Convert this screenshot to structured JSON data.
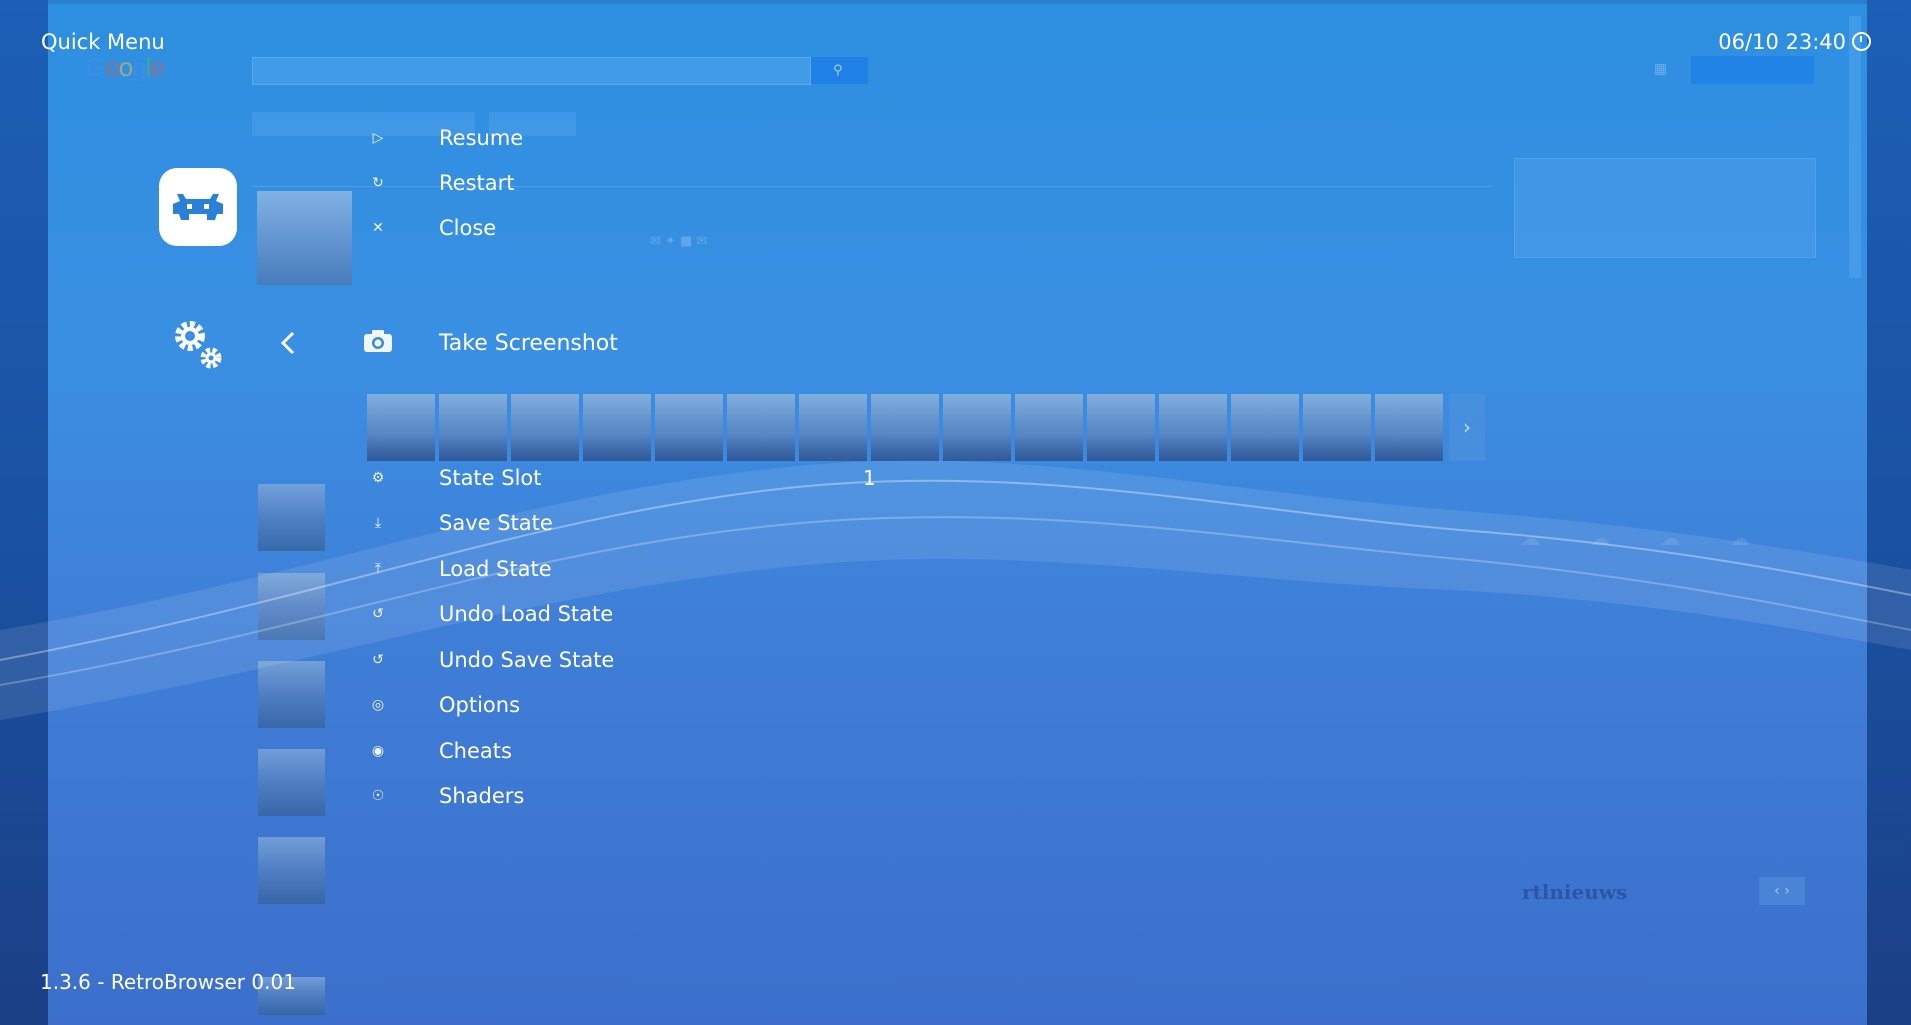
{
  "header": {
    "title": "Quick Menu",
    "clock": "06/10 23:40"
  },
  "footer": {
    "version": "1.3.6 - RetroBrowser 0.01"
  },
  "background_page": {
    "logo": "Google",
    "news_logo": "rtlnieuws"
  },
  "menu_top": [
    {
      "label": "Resume",
      "icon": "play-icon"
    },
    {
      "label": "Restart",
      "icon": "restart-icon"
    },
    {
      "label": "Close",
      "icon": "close-icon"
    }
  ],
  "screenshot_item": {
    "label": "Take Screenshot",
    "icon": "camera-icon"
  },
  "menu_items": [
    {
      "label": "State Slot",
      "icon": "gear-icon",
      "value": "1"
    },
    {
      "label": "Save State",
      "icon": "download-icon"
    },
    {
      "label": "Load State",
      "icon": "upload-icon"
    },
    {
      "label": "Undo Load State",
      "icon": "undo-icon"
    },
    {
      "label": "Undo Save State",
      "icon": "undo-icon"
    },
    {
      "label": "Options",
      "icon": "options-icon"
    },
    {
      "label": "Cheats",
      "icon": "cheats-icon"
    },
    {
      "label": "Shaders",
      "icon": "shaders-icon"
    }
  ],
  "colors": {
    "background_top": "#2d8fe0",
    "background_bottom": "#3b6fcb",
    "text": "#ffffff",
    "accent": "#1d7fe6"
  }
}
